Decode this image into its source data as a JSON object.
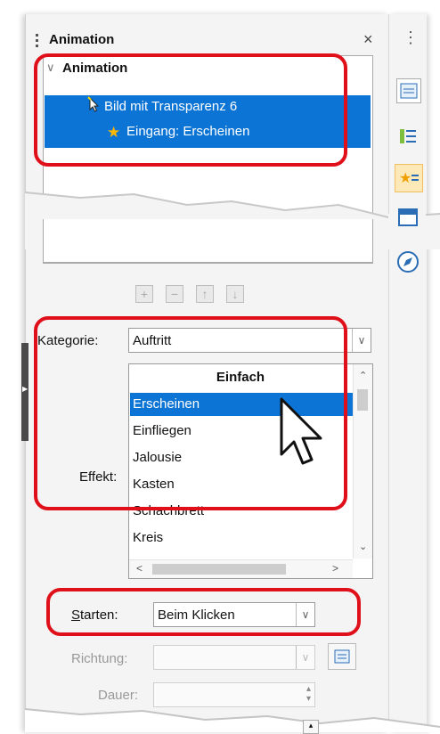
{
  "panel": {
    "title": "Animation",
    "close_glyph": "×",
    "more_glyph": "⋮"
  },
  "animation_list": {
    "heading": "Animation",
    "items": [
      {
        "label": "Bild mit Transparenz 6",
        "icon": "pointer-click-icon"
      },
      {
        "label": "Eingang: Erscheinen",
        "icon": "star-icon"
      }
    ]
  },
  "list_buttons": {
    "add": "+",
    "remove": "−",
    "up": "↑",
    "down": "↓"
  },
  "kategorie": {
    "label": "Kategorie:",
    "value": "Auftritt"
  },
  "effekt": {
    "label": "Effekt:",
    "group_header": "Einfach",
    "items": [
      "Erscheinen",
      "Einfliegen",
      "Jalousie",
      "Kasten",
      "Schachbrett",
      "Kreis"
    ],
    "selected": "Erscheinen"
  },
  "starten": {
    "label": "Starten:",
    "value": "Beim Klicken"
  },
  "richtung": {
    "label": "Richtung:",
    "value": ""
  },
  "dauer": {
    "label": "Dauer:",
    "value": ""
  },
  "colors": {
    "highlight": "#0c74d4",
    "annotation": "#e0101a"
  }
}
